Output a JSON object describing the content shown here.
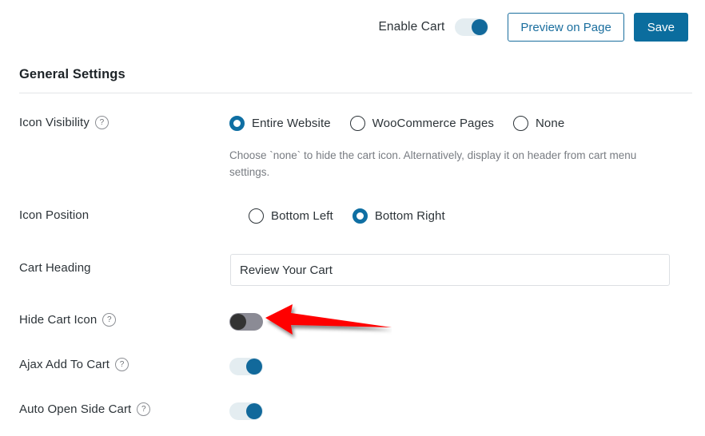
{
  "topbar": {
    "enable_cart_label": "Enable Cart",
    "enable_cart_state": "on",
    "preview_button": "Preview on Page",
    "save_button": "Save",
    "accent_color": "#0b6d9e"
  },
  "section": {
    "title": "General Settings"
  },
  "rows": {
    "icon_visibility": {
      "label": "Icon Visibility",
      "help": "?",
      "options": [
        {
          "label": "Entire Website",
          "selected": true
        },
        {
          "label": "WooCommerce Pages",
          "selected": false
        },
        {
          "label": "None",
          "selected": false
        }
      ],
      "helptext": "Choose `none` to hide the cart icon. Alternatively, display it on header from cart menu settings."
    },
    "icon_position": {
      "label": "Icon Position",
      "options": [
        {
          "label": "Bottom Left",
          "selected": false
        },
        {
          "label": "Bottom Right",
          "selected": true
        }
      ]
    },
    "cart_heading": {
      "label": "Cart Heading",
      "value": "Review Your Cart",
      "placeholder": "Review Your Cart"
    },
    "hide_cart_icon": {
      "label": "Hide Cart Icon",
      "help": "?",
      "state": "off"
    },
    "ajax_add_to_cart": {
      "label": "Ajax Add To Cart",
      "help": "?",
      "state": "on"
    },
    "auto_open_side_cart": {
      "label": "Auto Open Side Cart",
      "help": "?",
      "state": "on"
    }
  },
  "annotation": {
    "arrow_color": "#ff0000",
    "points_to": "hide-cart-icon-toggle"
  }
}
